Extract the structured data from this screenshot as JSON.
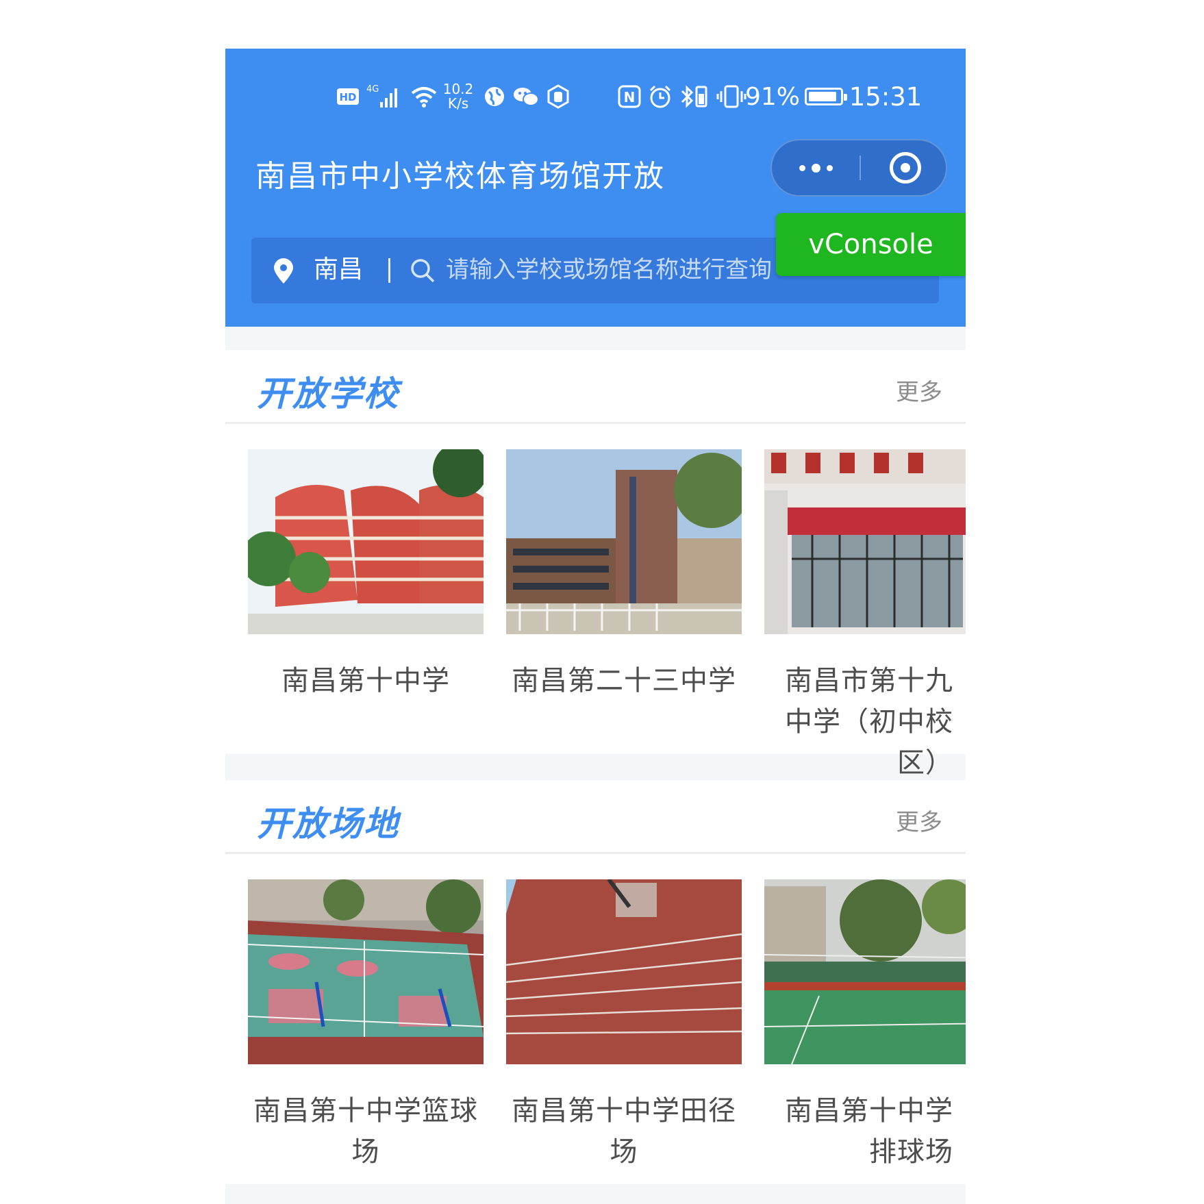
{
  "status_bar": {
    "hd": "HD",
    "network": "4G",
    "net_speed_value": "10.2",
    "net_speed_unit": "K/s",
    "nfc": "N",
    "battery_percent": "91%",
    "battery_level": 0.91,
    "time": "15:31"
  },
  "header": {
    "title": "南昌市中小学校体育场馆开放",
    "vconsole_label": "vConsole"
  },
  "search": {
    "city": "南昌",
    "placeholder": "请输入学校或场馆名称进行查询"
  },
  "open_schools": {
    "title": "开放学校",
    "more_label": "更多",
    "items": [
      {
        "name": "南昌第十中学"
      },
      {
        "name": "南昌第二十三中学"
      },
      {
        "name": "南昌市第十九中学（初中校区）"
      }
    ]
  },
  "open_venues": {
    "title": "开放场地",
    "more_label": "更多",
    "items": [
      {
        "name": "南昌第十中学篮球场"
      },
      {
        "name": "南昌第十中学田径场"
      },
      {
        "name": "南昌第十中学排球场"
      }
    ]
  },
  "colors": {
    "brand_blue": "#3d8ef0",
    "vconsole_green": "#1fb71f"
  }
}
